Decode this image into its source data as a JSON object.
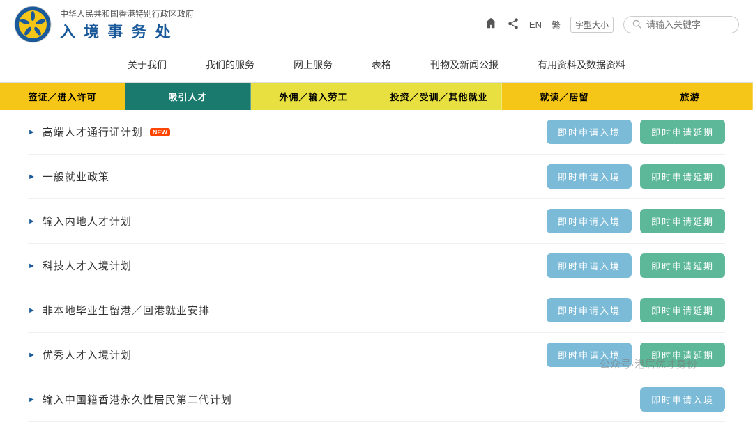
{
  "header": {
    "gov_name": "中华人民共和国香港特别行政区政府",
    "dept_name": "入 境 事 务 处",
    "home_icon": "🏠",
    "share_icon": "share",
    "lang_en": "EN",
    "lang_trad": "繁",
    "font_size": "字型大小",
    "search_placeholder": "请输入关键字"
  },
  "main_nav": {
    "items": [
      {
        "label": "关于我们"
      },
      {
        "label": "我们的服务"
      },
      {
        "label": "网上服务"
      },
      {
        "label": "表格"
      },
      {
        "label": "刊物及新闻公报"
      },
      {
        "label": "有用资料及数据资料"
      }
    ]
  },
  "sub_nav": {
    "items": [
      {
        "label": "签证／进入许可",
        "style": "yellow"
      },
      {
        "label": "吸引人才",
        "style": "teal"
      },
      {
        "label": "外佣／输入劳工",
        "style": "light-yellow"
      },
      {
        "label": "投资／受训／其他就业",
        "style": "light-yellow2"
      },
      {
        "label": "就读／居留",
        "style": "yellow2"
      },
      {
        "label": "旅游",
        "style": "yellow3"
      }
    ]
  },
  "content": {
    "rows": [
      {
        "title": "高端人才通行证计划",
        "has_new": true,
        "btn1": "即时申请入境",
        "btn2": "即时申请延期"
      },
      {
        "title": "一般就业政策",
        "has_new": false,
        "btn1": "即时申请入境",
        "btn2": "即时申请延期"
      },
      {
        "title": "输入内地人才计划",
        "has_new": false,
        "btn1": "即时申请入境",
        "btn2": "即时申请延期"
      },
      {
        "title": "科技人才入境计划",
        "has_new": false,
        "btn1": "即时申请入境",
        "btn2": "即时申请延期"
      },
      {
        "title": "非本地毕业生留港／回港就业安排",
        "has_new": false,
        "btn1": "即时申请入境",
        "btn2": "即时申请延期"
      },
      {
        "title": "优秀人才入境计划",
        "has_new": false,
        "btn1": "即时申请入境",
        "btn2": "即时申请延期"
      },
      {
        "title": "输入中国籍香港永久性居民第二代计划",
        "has_new": false,
        "btn1": "即时申请入境",
        "btn2": ""
      }
    ]
  },
  "watermark": "公众号·港居优才身份"
}
